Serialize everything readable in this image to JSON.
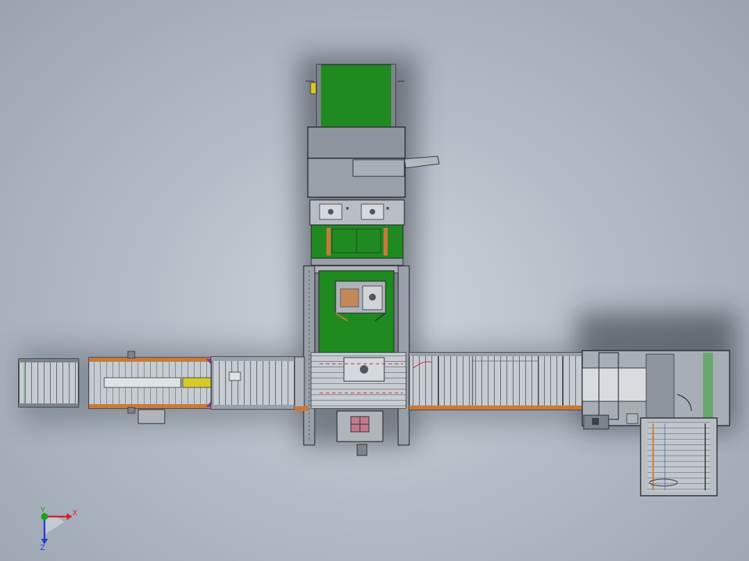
{
  "viewport": {
    "triad": {
      "x_label": "X",
      "y_label": "Y",
      "z_label": "Z"
    }
  },
  "colors": {
    "background": "#b3bcc6",
    "belt_green": "#1f8a1f",
    "frame_gray": "#9aa0a8",
    "roller_gray": "#c9ced4",
    "rail_orange": "#c97a3a",
    "accent_yellow": "#d6c92a",
    "line_dark": "#2b2f36",
    "axis_red": "#d8202a",
    "axis_green": "#1aa11a",
    "axis_blue": "#1e3fd0"
  }
}
